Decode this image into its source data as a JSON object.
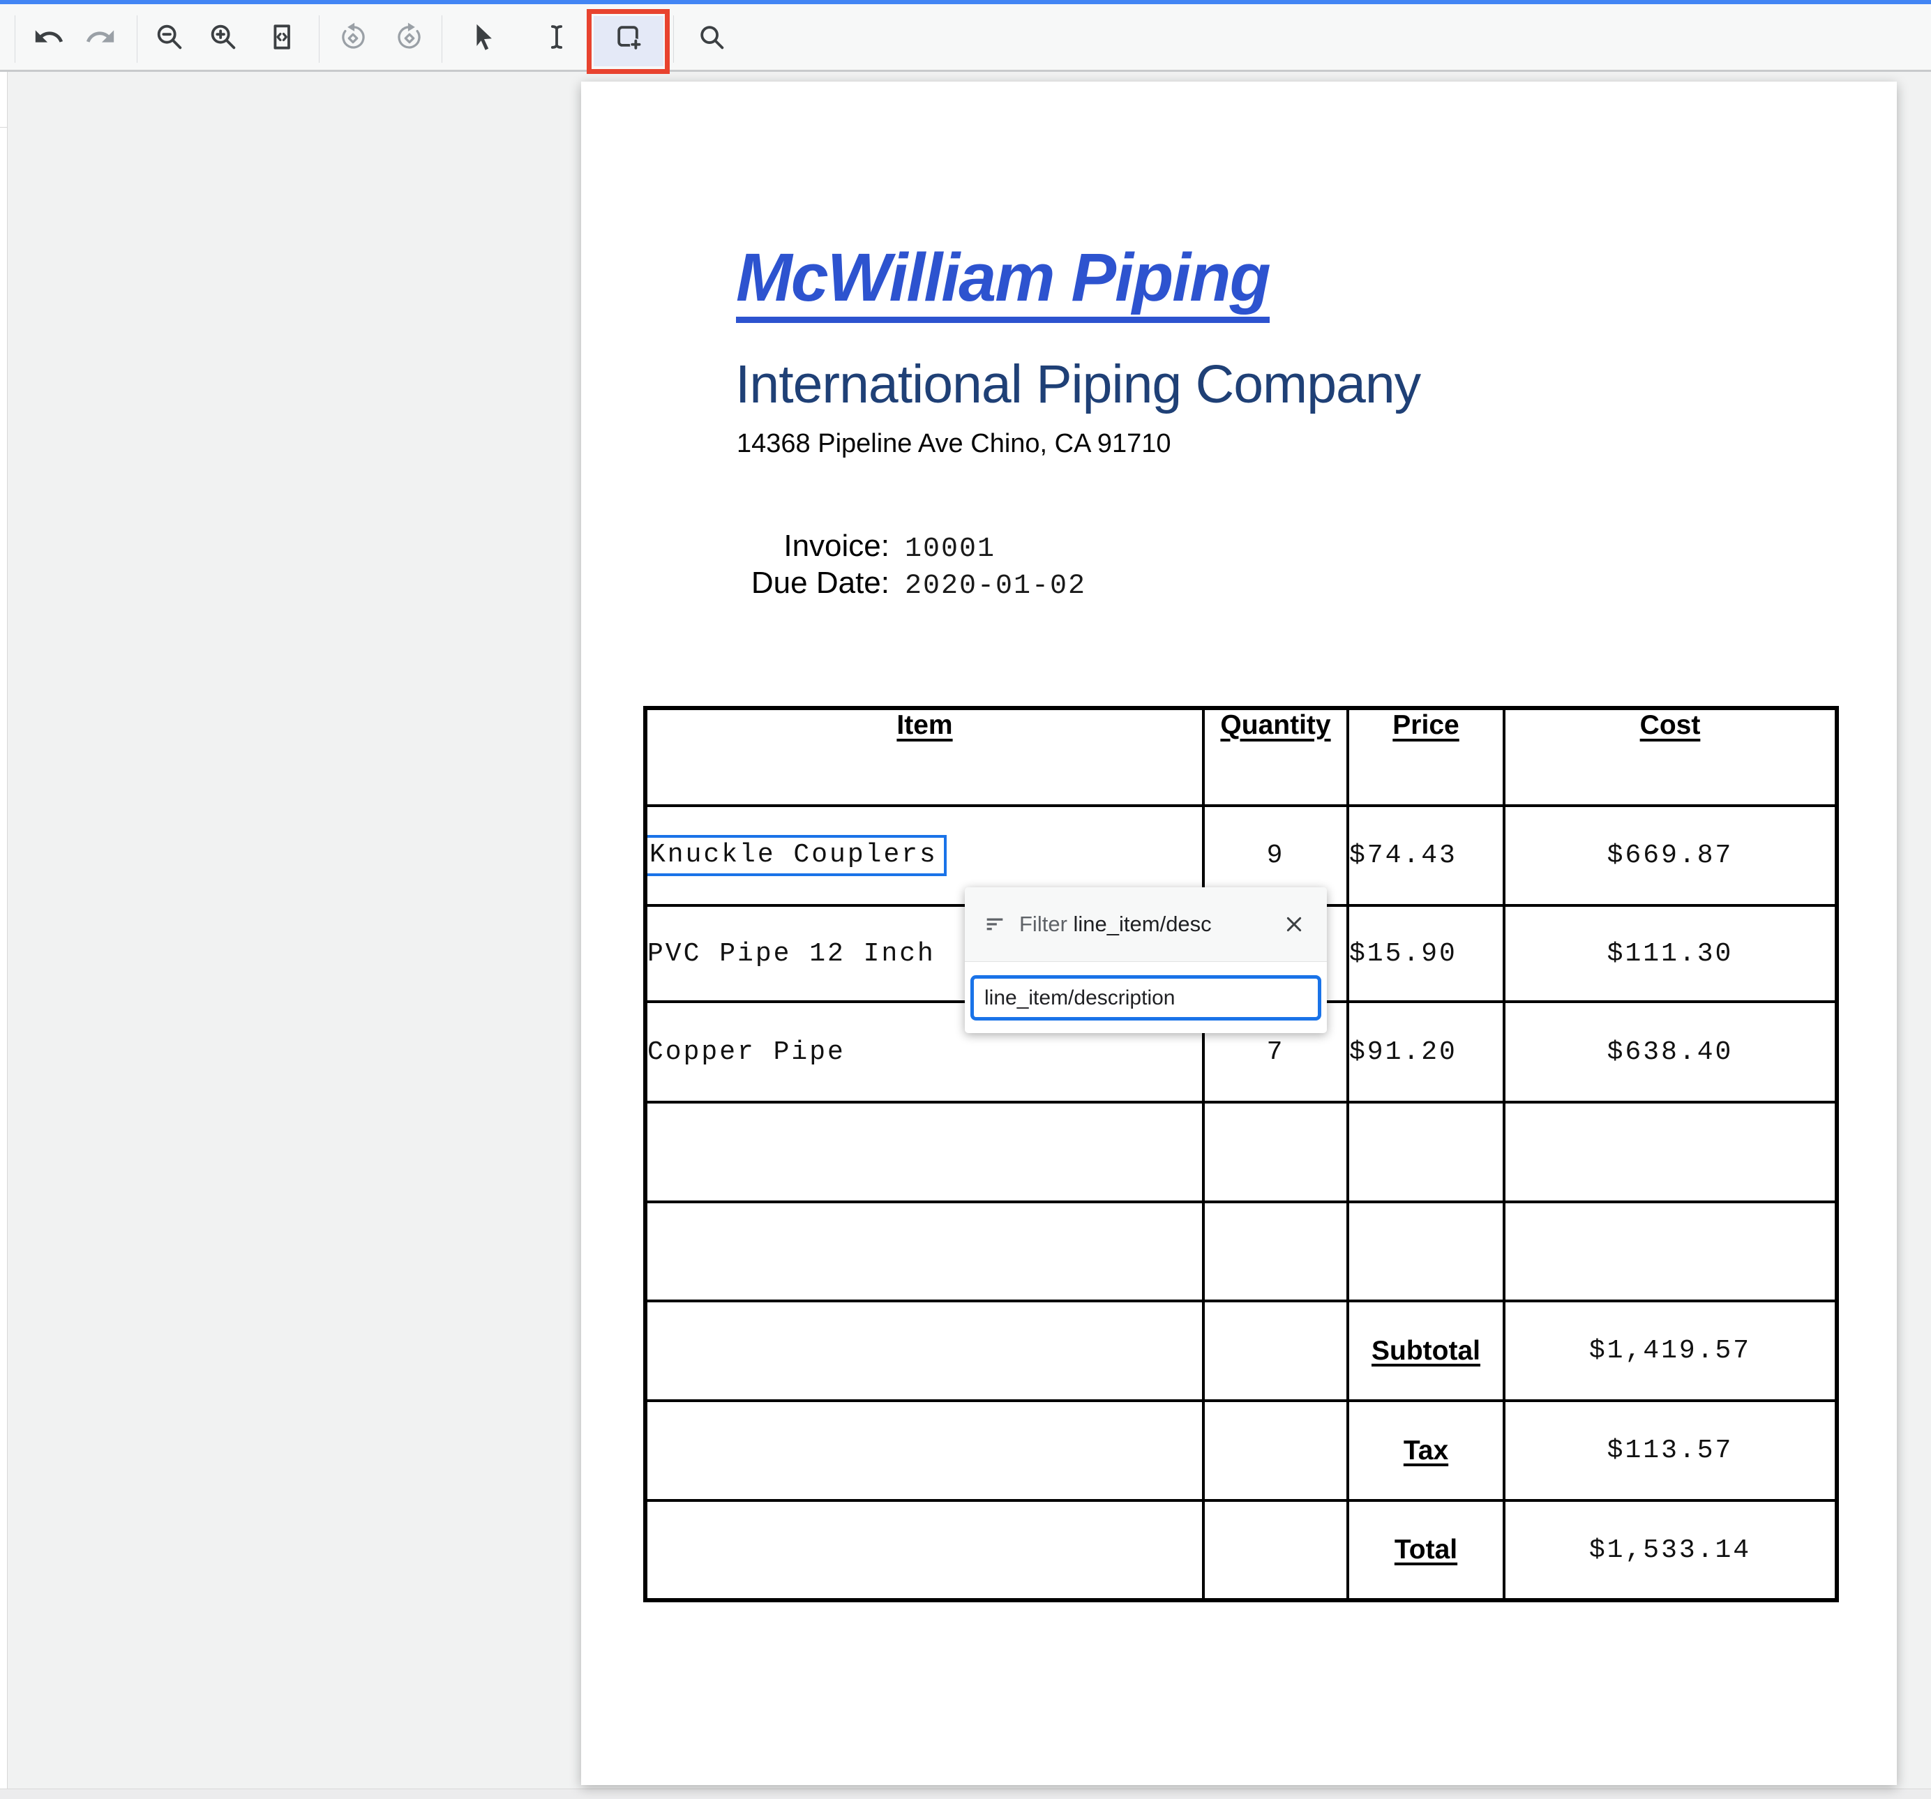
{
  "toolbar": {
    "tools": [
      {
        "name": "undo",
        "enabled": true
      },
      {
        "name": "redo",
        "enabled": false
      },
      {
        "name": "zoom-out",
        "enabled": true
      },
      {
        "name": "zoom-in",
        "enabled": true
      },
      {
        "name": "fit-to-width",
        "enabled": true
      },
      {
        "name": "rotate-counterclockwise",
        "enabled": false
      },
      {
        "name": "rotate-clockwise",
        "enabled": false
      },
      {
        "name": "select-cursor",
        "enabled": true
      },
      {
        "name": "text-select",
        "enabled": true
      },
      {
        "name": "add-bounding-box",
        "enabled": true,
        "selected": true,
        "highlighted_red": true
      },
      {
        "name": "search",
        "enabled": true
      }
    ]
  },
  "invoice": {
    "company_title": "McWilliam Piping",
    "company_subtitle": "International Piping Company",
    "address": "14368 Pipeline Ave Chino, CA 91710",
    "fields": [
      {
        "label": "Invoice:",
        "value": "10001"
      },
      {
        "label": "Due Date:",
        "value": "2020-01-02"
      }
    ],
    "table": {
      "headers": [
        "Item",
        "Quantity",
        "Price",
        "Cost"
      ],
      "rows": [
        {
          "item": "Knuckle Couplers",
          "quantity": "9",
          "price": "$74.43",
          "cost": "$669.87",
          "item_boxed": true
        },
        {
          "item": "PVC Pipe 12 Inch",
          "quantity": "",
          "price": "$15.90",
          "cost": "$111.30"
        },
        {
          "item": "Copper Pipe",
          "quantity": "7",
          "price": "$91.20",
          "cost": "$638.40"
        },
        {
          "item": "",
          "quantity": "",
          "price": "",
          "cost": ""
        },
        {
          "item": "",
          "quantity": "",
          "price": "",
          "cost": ""
        }
      ],
      "summary": [
        {
          "label": "Subtotal",
          "value": "$1,419.57"
        },
        {
          "label": "Tax",
          "value": "$113.57"
        },
        {
          "label": "Total",
          "value": "$1,533.14"
        }
      ]
    }
  },
  "popup": {
    "filter_label": "Filter",
    "filter_field": "line_item/desc",
    "input_value": "line_item/description"
  },
  "colors": {
    "accent_blue": "#1a73e8",
    "top_strip_blue": "#4285f4",
    "title_blue": "#2d53cf",
    "subtitle_blue": "#1f4076",
    "tool_highlight_red": "#e8432f",
    "selected_tool_bg": "#e4e9f7"
  }
}
